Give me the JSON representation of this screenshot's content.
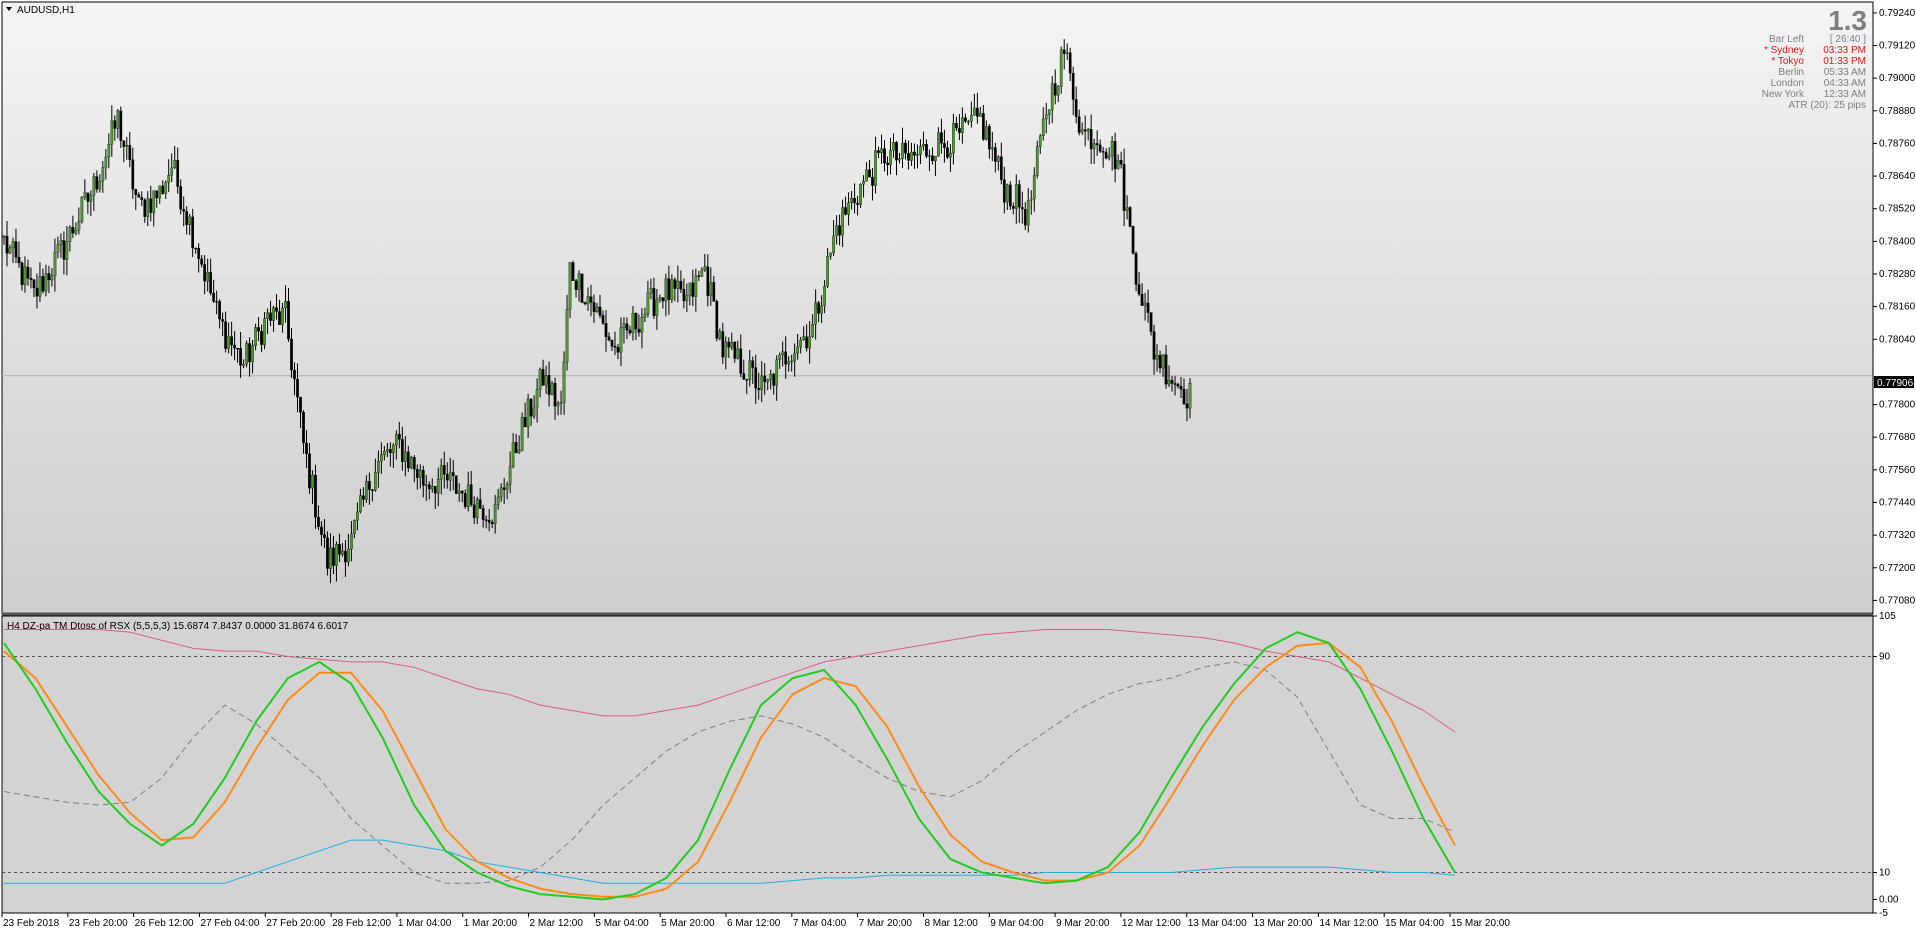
{
  "chart_window": {
    "symbol_label": "AUDUSD,H1",
    "current_price": "0.77906",
    "price_axis_ticks": [
      "0.79240",
      "0.79120",
      "0.79000",
      "0.78880",
      "0.78760",
      "0.78640",
      "0.78520",
      "0.78400",
      "0.78280",
      "0.78160",
      "0.78040",
      "0.77800",
      "0.77680",
      "0.77560",
      "0.77440",
      "0.77320",
      "0.77200",
      "0.77080"
    ],
    "big_number": "1.3",
    "bar_left": {
      "label": "Bar Left",
      "value": "[ 26:40 ]"
    },
    "sessions": [
      {
        "name": "* Sydney",
        "time": "03:33 PM",
        "active": true
      },
      {
        "name": "* Tokyo",
        "time": "01:33 PM",
        "active": true
      },
      {
        "name": "Berlin",
        "time": "05:33 AM",
        "active": false
      },
      {
        "name": "London",
        "time": "04:33 AM",
        "active": false
      },
      {
        "name": "New York",
        "time": "12:33 AM",
        "active": false
      }
    ],
    "atr_text": "ATR (20): 25 pips",
    "colors": {
      "bull": "#4c9a2a",
      "bear": "#000000",
      "background_top": "#f4f4f4",
      "background_bottom": "#cccccc"
    }
  },
  "indicator_window": {
    "label": "H4  DZ-pa TM Dtosc of RSX  (5,5,5,3) 15.6874 7.8437 0.0000 31.8674 6.6017",
    "axis_ticks": [
      "105",
      "90",
      "10",
      "0.00",
      "-5"
    ],
    "levels": [
      90,
      10
    ],
    "colors": {
      "fast": "#22cc22",
      "signal": "#ff8c1a",
      "upper": "#d9607a",
      "lower": "#1fb2e0",
      "middle": "#808080"
    }
  },
  "time_axis": [
    "23 Feb 2018",
    "23 Feb 20:00",
    "26 Feb 12:00",
    "27 Feb 04:00",
    "27 Feb 20:00",
    "28 Feb 12:00",
    "1 Mar 04:00",
    "1 Mar 20:00",
    "2 Mar 12:00",
    "5 Mar 04:00",
    "5 Mar 20:00",
    "6 Mar 12:00",
    "7 Mar 04:00",
    "7 Mar 20:00",
    "8 Mar 12:00",
    "9 Mar 04:00",
    "9 Mar 20:00",
    "12 Mar 12:00",
    "13 Mar 04:00",
    "13 Mar 20:00",
    "14 Mar 12:00",
    "15 Mar 04:00",
    "15 Mar 20:00"
  ],
  "chart_data": [
    {
      "type": "candlestick",
      "title": "AUDUSD,H1",
      "ylim": [
        0.7703,
        0.7928
      ],
      "anchors_close": [
        [
          0,
          0.784
        ],
        [
          10,
          0.782
        ],
        [
          20,
          0.7838
        ],
        [
          30,
          0.786
        ],
        [
          38,
          0.7885
        ],
        [
          45,
          0.7852
        ],
        [
          52,
          0.7858
        ],
        [
          56,
          0.7868
        ],
        [
          64,
          0.784
        ],
        [
          72,
          0.781
        ],
        [
          80,
          0.7795
        ],
        [
          88,
          0.7812
        ],
        [
          94,
          0.7812
        ],
        [
          100,
          0.7765
        ],
        [
          108,
          0.7722
        ],
        [
          116,
          0.773
        ],
        [
          124,
          0.7758
        ],
        [
          132,
          0.7765
        ],
        [
          140,
          0.7752
        ],
        [
          148,
          0.7752
        ],
        [
          156,
          0.7745
        ],
        [
          164,
          0.774
        ],
        [
          172,
          0.7768
        ],
        [
          180,
          0.779
        ],
        [
          186,
          0.7778
        ],
        [
          189,
          0.783
        ],
        [
          196,
          0.7818
        ],
        [
          204,
          0.78
        ],
        [
          212,
          0.7812
        ],
        [
          220,
          0.7822
        ],
        [
          228,
          0.7818
        ],
        [
          234,
          0.783
        ],
        [
          240,
          0.78
        ],
        [
          246,
          0.7795
        ],
        [
          254,
          0.7785
        ],
        [
          262,
          0.78
        ],
        [
          270,
          0.7808
        ],
        [
          278,
          0.7845
        ],
        [
          286,
          0.786
        ],
        [
          294,
          0.7872
        ],
        [
          302,
          0.787
        ],
        [
          310,
          0.7875
        ],
        [
          318,
          0.7878
        ],
        [
          326,
          0.7885
        ],
        [
          334,
          0.786
        ],
        [
          342,
          0.785
        ],
        [
          348,
          0.7888
        ],
        [
          354,
          0.791
        ],
        [
          360,
          0.788
        ],
        [
          366,
          0.7878
        ],
        [
          372,
          0.787
        ],
        [
          378,
          0.783
        ],
        [
          384,
          0.78
        ],
        [
          390,
          0.779
        ],
        [
          396,
          0.7783
        ]
      ],
      "candle_count": 397
    },
    {
      "type": "line",
      "title": "DZ-pa TM Dtosc of RSX",
      "ylim": [
        -5,
        105
      ],
      "x_points": 47,
      "series": [
        {
          "key": "fast",
          "values": [
            95,
            78,
            58,
            40,
            28,
            20,
            28,
            45,
            66,
            82,
            88,
            80,
            60,
            35,
            18,
            10,
            5,
            2,
            1,
            0,
            2,
            8,
            22,
            48,
            72,
            82,
            85,
            72,
            52,
            30,
            15,
            10,
            8,
            6,
            7,
            12,
            25,
            45,
            64,
            80,
            93,
            99,
            95,
            78,
            55,
            30,
            10
          ]
        },
        {
          "key": "signal",
          "values": [
            92,
            82,
            64,
            46,
            32,
            22,
            23,
            36,
            56,
            74,
            84,
            84,
            70,
            48,
            26,
            14,
            8,
            4,
            2,
            1,
            1,
            4,
            14,
            36,
            60,
            76,
            82,
            79,
            64,
            42,
            24,
            14,
            10,
            7,
            7,
            10,
            20,
            38,
            57,
            74,
            86,
            94,
            95,
            86,
            66,
            42,
            20
          ]
        },
        {
          "key": "upper",
          "values": [
            100,
            100,
            100,
            100,
            99,
            96,
            93,
            92,
            92,
            90,
            89,
            88,
            88,
            86,
            82,
            78,
            76,
            72,
            70,
            68,
            68,
            70,
            72,
            76,
            80,
            84,
            88,
            90,
            92,
            94,
            96,
            98,
            99,
            100,
            100,
            100,
            99,
            98,
            97,
            95,
            92,
            90,
            88,
            82,
            76,
            70,
            62
          ]
        },
        {
          "key": "lower",
          "values": [
            6,
            6,
            6,
            6,
            6,
            6,
            6,
            6,
            10,
            14,
            18,
            22,
            22,
            20,
            18,
            14,
            12,
            10,
            8,
            6,
            6,
            6,
            6,
            6,
            6,
            7,
            8,
            8,
            9,
            9,
            9,
            9,
            9,
            10,
            10,
            10,
            10,
            10,
            11,
            12,
            12,
            12,
            12,
            11,
            10,
            10,
            9
          ]
        },
        {
          "key": "middle",
          "values": [
            40,
            38,
            36,
            35,
            36,
            45,
            60,
            72,
            65,
            55,
            45,
            30,
            20,
            10,
            6,
            6,
            7,
            12,
            22,
            35,
            45,
            55,
            62,
            66,
            68,
            65,
            60,
            52,
            45,
            40,
            38,
            44,
            54,
            62,
            70,
            76,
            80,
            82,
            86,
            88,
            85,
            75,
            55,
            35,
            30,
            30,
            25
          ]
        }
      ]
    }
  ]
}
